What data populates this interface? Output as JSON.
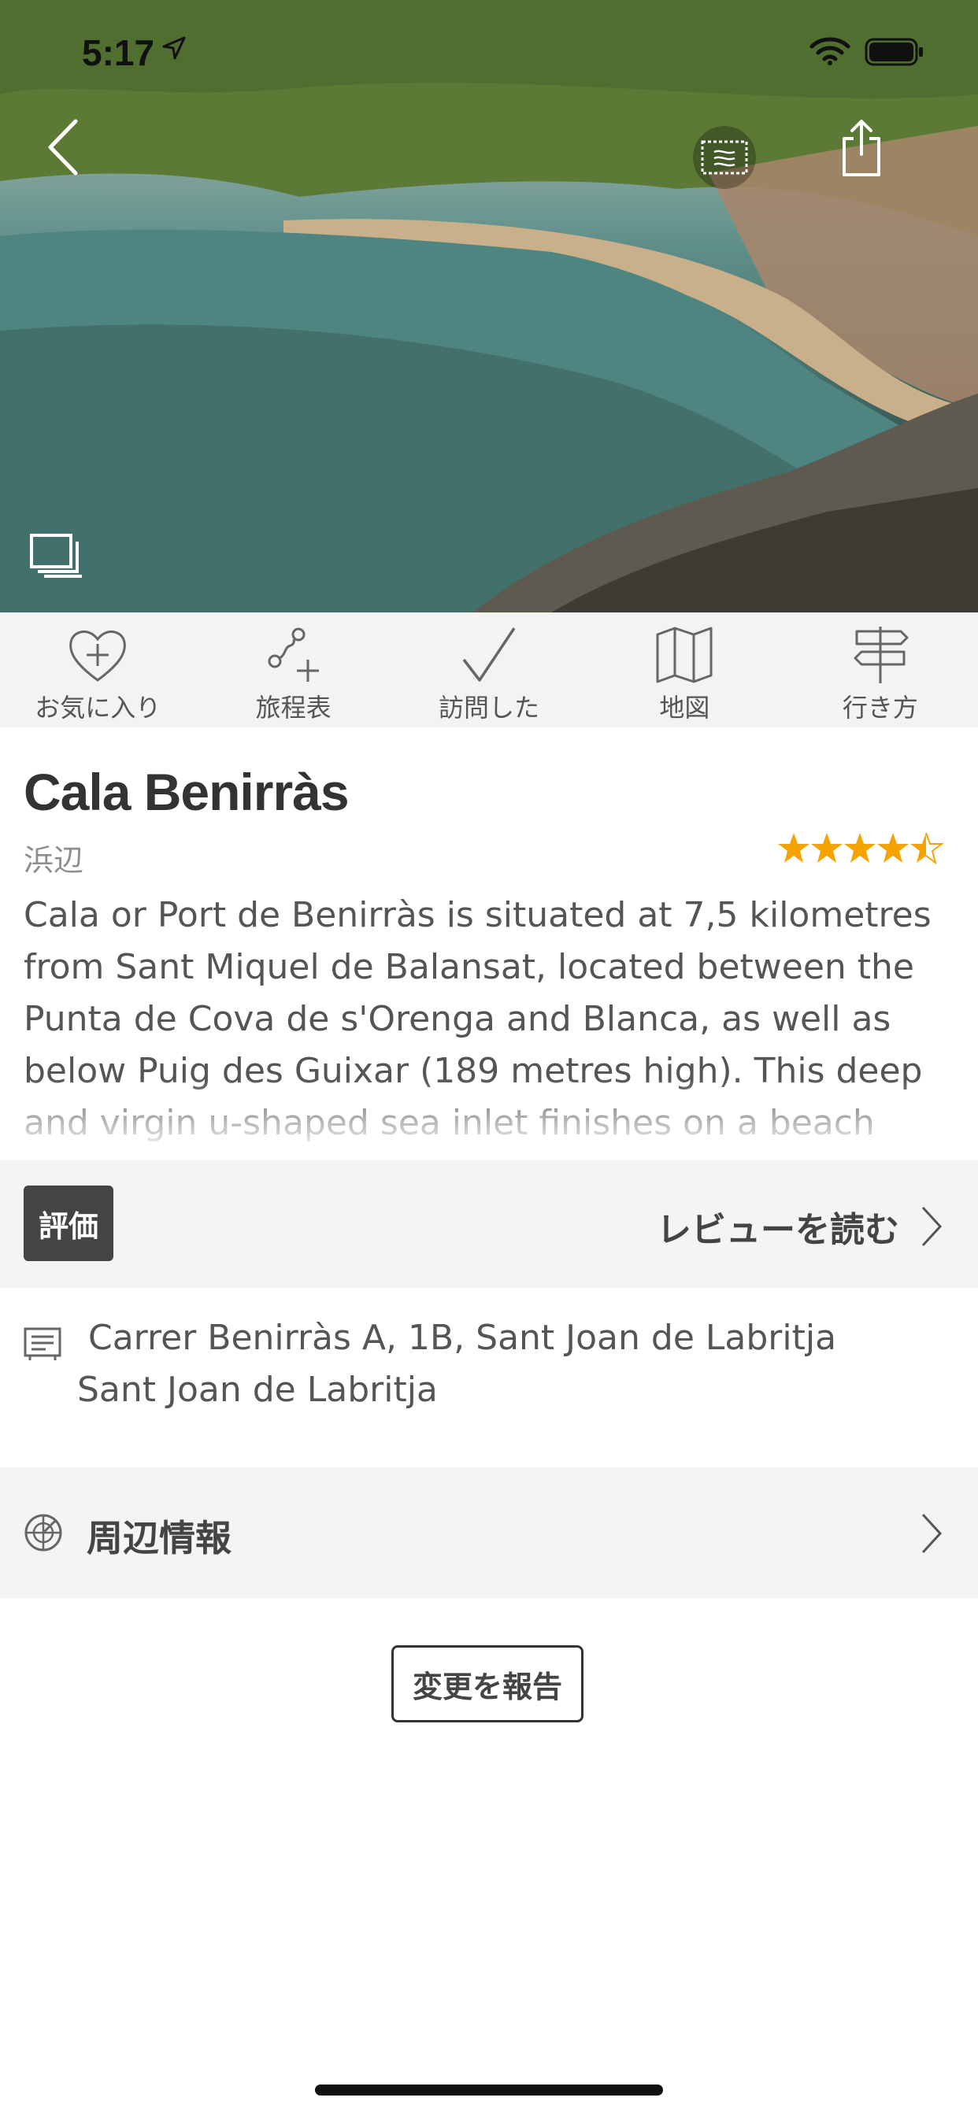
{
  "status_bar": {
    "time": "5:17"
  },
  "action_bar": {
    "items": [
      {
        "label": "お気に入り",
        "icon": "heart-plus-icon"
      },
      {
        "label": "旅程表",
        "icon": "route-add-icon"
      },
      {
        "label": "訪問した",
        "icon": "check-icon"
      },
      {
        "label": "地図",
        "icon": "map-icon"
      },
      {
        "label": "行き方",
        "icon": "signpost-icon"
      }
    ]
  },
  "place": {
    "title": "Cala Benirràs",
    "category": "浜辺",
    "rating": 4.5,
    "description": "Cala or Port de Benirràs is situated at 7,5 kilometres from Sant Miquel de Balansat, located between the Punta de Cova de s'Orenga and Blanca, as well as below Puig des Guixar (189 metres high). This deep and virgin u-shaped sea inlet finishes on a beach which is not too big, with"
  },
  "review": {
    "badge": "評価",
    "link": "レビューを読む"
  },
  "address": {
    "line1": "Carrer Benirràs A, 1B, Sant Joan de Labritja",
    "line2": "Sant Joan de Labritja"
  },
  "nearby": {
    "label": "周辺情報"
  },
  "report": {
    "label": "変更を報告"
  },
  "colors": {
    "star": "#f5a300",
    "action_bar_bg": "#f3f3f3",
    "row_bg": "#f4f4f4"
  }
}
